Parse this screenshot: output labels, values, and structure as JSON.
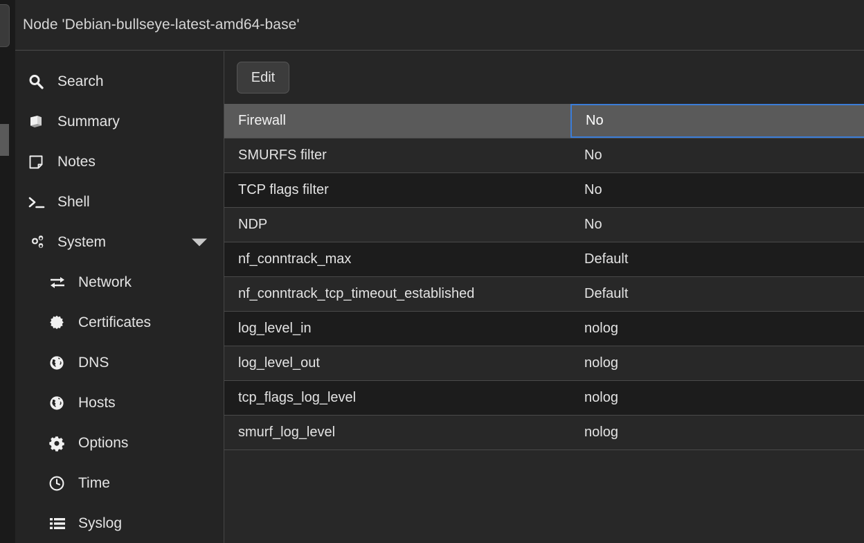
{
  "window": {
    "title": "Node 'Debian-bullseye-latest-amd64-base'"
  },
  "colors": {
    "accent_selection": "#3b7dd8",
    "row_selected_bg": "#5a5a5a",
    "row_odd_bg": "#1c1c1c",
    "row_even_bg": "#282828",
    "panel_bg": "#262626",
    "text": "#e3e3e3"
  },
  "sidebar": {
    "items": [
      {
        "label": "Search",
        "icon": "search-icon",
        "level": 0,
        "expandable": false
      },
      {
        "label": "Summary",
        "icon": "book-icon",
        "level": 0,
        "expandable": false
      },
      {
        "label": "Notes",
        "icon": "note-icon",
        "level": 0,
        "expandable": false
      },
      {
        "label": "Shell",
        "icon": "terminal-icon",
        "level": 0,
        "expandable": false
      },
      {
        "label": "System",
        "icon": "gears-icon",
        "level": 0,
        "expandable": true
      },
      {
        "label": "Network",
        "icon": "exchange-icon",
        "level": 1,
        "expandable": false
      },
      {
        "label": "Certificates",
        "icon": "certificate-icon",
        "level": 1,
        "expandable": false
      },
      {
        "label": "DNS",
        "icon": "globe-icon",
        "level": 1,
        "expandable": false
      },
      {
        "label": "Hosts",
        "icon": "globe-icon",
        "level": 1,
        "expandable": false
      },
      {
        "label": "Options",
        "icon": "gear-icon",
        "level": 1,
        "expandable": false
      },
      {
        "label": "Time",
        "icon": "clock-icon",
        "level": 1,
        "expandable": false
      },
      {
        "label": "Syslog",
        "icon": "list-icon",
        "level": 1,
        "expandable": false
      }
    ]
  },
  "toolbar": {
    "edit_label": "Edit"
  },
  "table": {
    "rows": [
      {
        "key": "Firewall",
        "value": "No",
        "selected": true
      },
      {
        "key": "SMURFS filter",
        "value": "No",
        "selected": false
      },
      {
        "key": "TCP flags filter",
        "value": "No",
        "selected": false
      },
      {
        "key": "NDP",
        "value": "No",
        "selected": false
      },
      {
        "key": "nf_conntrack_max",
        "value": "Default",
        "selected": false
      },
      {
        "key": "nf_conntrack_tcp_timeout_established",
        "value": "Default",
        "selected": false
      },
      {
        "key": "log_level_in",
        "value": "nolog",
        "selected": false
      },
      {
        "key": "log_level_out",
        "value": "nolog",
        "selected": false
      },
      {
        "key": "tcp_flags_log_level",
        "value": "nolog",
        "selected": false
      },
      {
        "key": "smurf_log_level",
        "value": "nolog",
        "selected": false
      }
    ]
  }
}
